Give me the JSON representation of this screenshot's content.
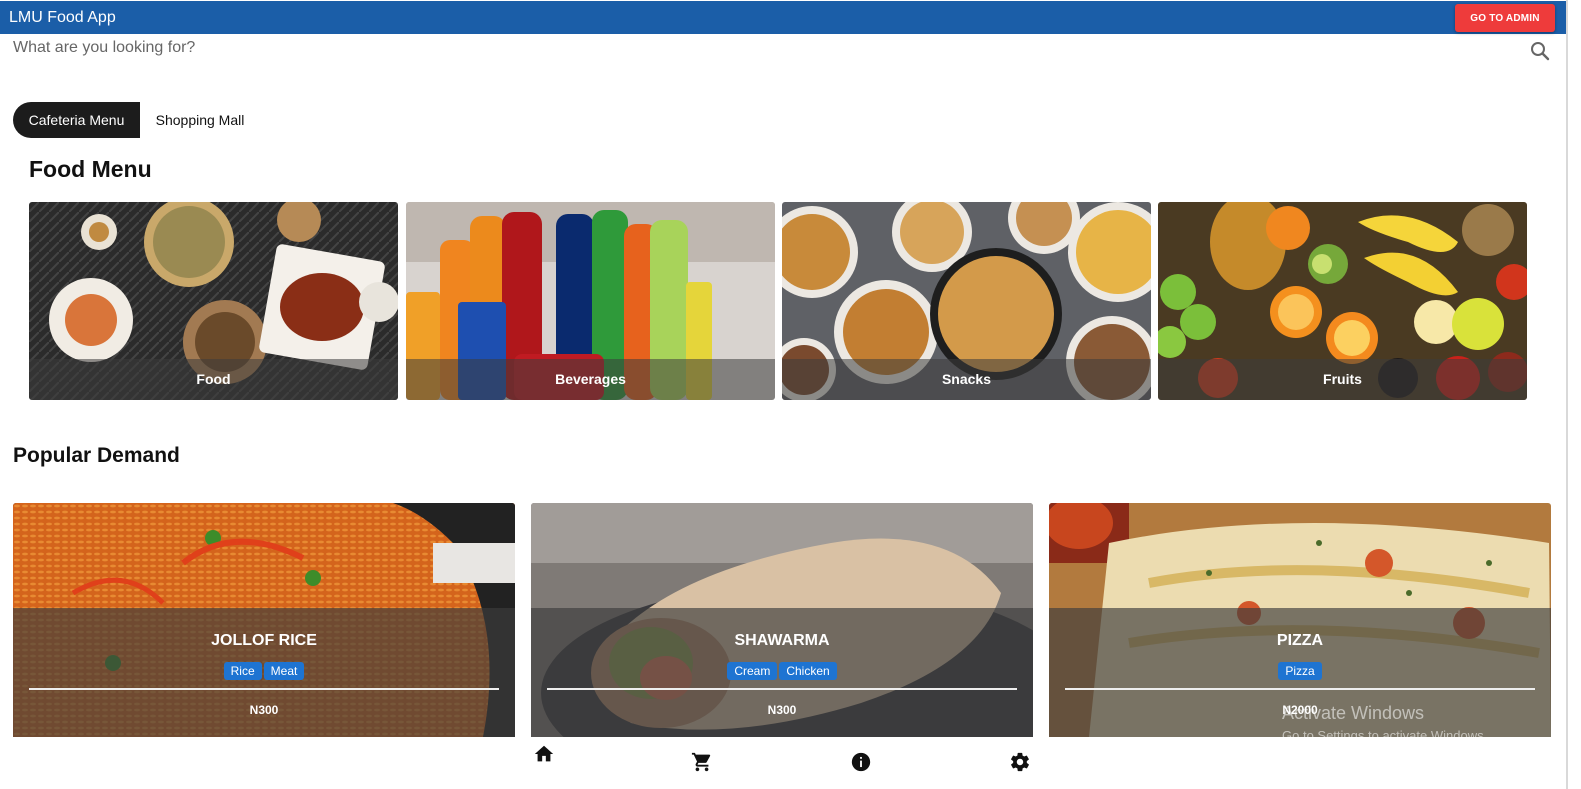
{
  "app": {
    "title": "LMU Food App",
    "admin_button": "GO TO ADMIN"
  },
  "search": {
    "placeholder": "What are you looking for?"
  },
  "tabs": [
    {
      "label": "Cafeteria Menu",
      "active": true
    },
    {
      "label": "Shopping Mall",
      "active": false
    }
  ],
  "food_menu": {
    "heading": "Food Menu",
    "categories": [
      {
        "label": "Food"
      },
      {
        "label": "Beverages"
      },
      {
        "label": "Snacks"
      },
      {
        "label": "Fruits"
      }
    ]
  },
  "popular": {
    "heading": "Popular Demand",
    "items": [
      {
        "name": "JOLLOF RICE",
        "tags": [
          "Rice",
          "Meat"
        ],
        "price": "N300"
      },
      {
        "name": "SHAWARMA",
        "tags": [
          "Cream",
          "Chicken"
        ],
        "price": "N300"
      },
      {
        "name": "PIZZA",
        "tags": [
          "Pizza"
        ],
        "price": "N2000"
      }
    ]
  },
  "watermark": {
    "line1": "Activate Windows",
    "line2": "Go to Settings to activate Windows."
  },
  "bottom_nav": [
    {
      "icon": "home-icon"
    },
    {
      "icon": "cart-icon"
    },
    {
      "icon": "info-icon"
    },
    {
      "icon": "settings-icon"
    }
  ],
  "colors": {
    "appbar": "#1b5ea8",
    "admin_button": "#ee3b3b",
    "tab_active": "#1c1c1c",
    "tag": "#1e74d2"
  }
}
